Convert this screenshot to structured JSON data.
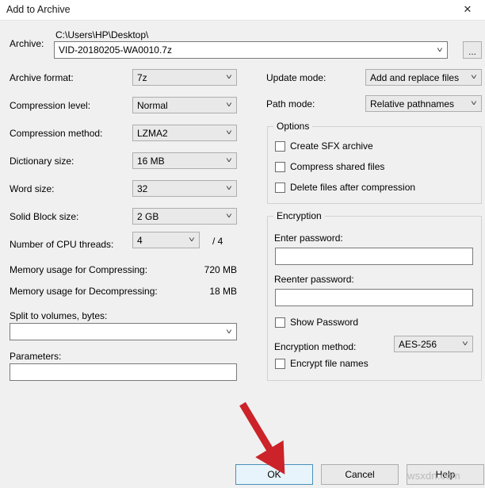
{
  "window": {
    "title": "Add to Archive",
    "close_icon": "close-icon"
  },
  "archive": {
    "label": "Archive:",
    "path": "C:\\Users\\HP\\Desktop\\",
    "filename": "VID-20180205-WA0010.7z",
    "browse_label": "..."
  },
  "left_column": {
    "archive_format": {
      "label": "Archive format:",
      "value": "7z"
    },
    "compression_level": {
      "label": "Compression level:",
      "value": "Normal"
    },
    "compression_method": {
      "label": "Compression method:",
      "value": "LZMA2"
    },
    "dictionary_size": {
      "label": "Dictionary size:",
      "value": "16 MB"
    },
    "word_size": {
      "label": "Word size:",
      "value": "32"
    },
    "solid_block_size": {
      "label": "Solid Block size:",
      "value": "2 GB"
    },
    "cpu_threads": {
      "label": "Number of CPU threads:",
      "value": "4",
      "total": "/ 4"
    },
    "memory_compress": {
      "label": "Memory usage for Compressing:",
      "value": "720 MB"
    },
    "memory_decompress": {
      "label": "Memory usage for Decompressing:",
      "value": "18 MB"
    },
    "split_volumes": {
      "label": "Split to volumes, bytes:",
      "value": ""
    },
    "parameters": {
      "label": "Parameters:",
      "value": ""
    }
  },
  "right_column": {
    "update_mode": {
      "label": "Update mode:",
      "value": "Add and replace files"
    },
    "path_mode": {
      "label": "Path mode:",
      "value": "Relative pathnames"
    },
    "options": {
      "legend": "Options",
      "items": [
        {
          "label": "Create SFX archive",
          "checked": false
        },
        {
          "label": "Compress shared files",
          "checked": false
        },
        {
          "label": "Delete files after compression",
          "checked": false
        }
      ]
    },
    "encryption": {
      "legend": "Encryption",
      "enter_password": {
        "label": "Enter password:",
        "value": ""
      },
      "reenter_password": {
        "label": "Reenter password:",
        "value": ""
      },
      "show_password": {
        "label": "Show Password",
        "checked": false
      },
      "encryption_method": {
        "label": "Encryption method:",
        "value": "AES-256"
      },
      "encrypt_file_names": {
        "label": "Encrypt file names",
        "checked": false
      }
    }
  },
  "buttons": {
    "ok": "OK",
    "cancel": "Cancel",
    "help": "Help"
  },
  "annotation": {
    "arrow_color": "#cc2229",
    "watermark": "wsxdn.com"
  }
}
